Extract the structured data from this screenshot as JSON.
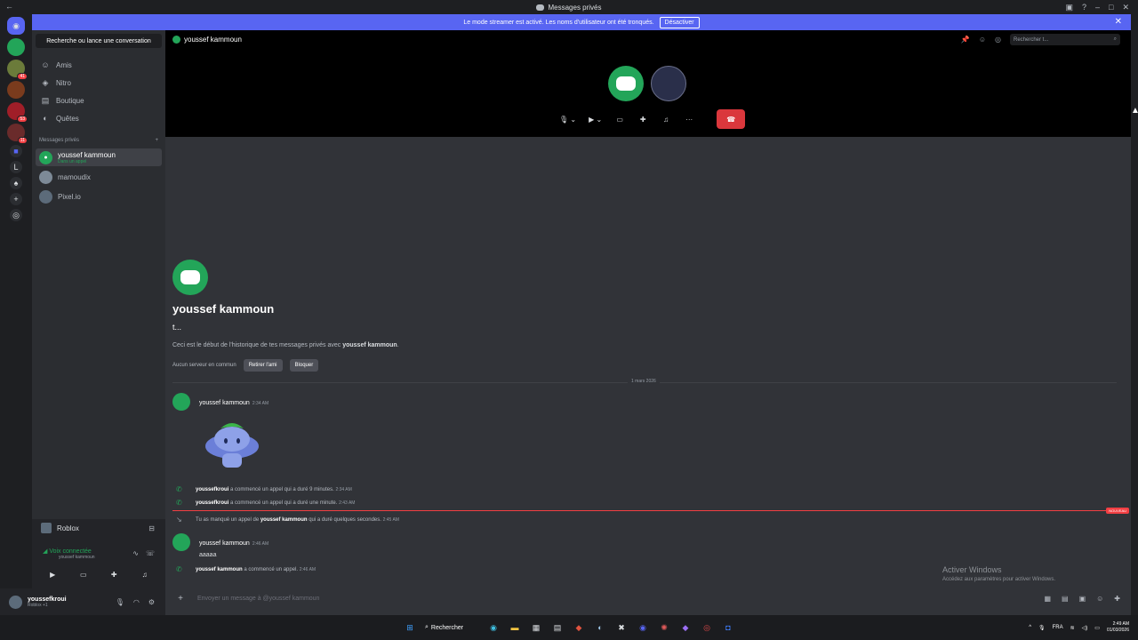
{
  "window": {
    "title": "Messages privés"
  },
  "banner": {
    "text": "Le mode streamer est activé. Les noms d'utilisateur ont été tronqués.",
    "button": "Désactiver"
  },
  "servers": [
    {
      "name": "home",
      "badge": ""
    },
    {
      "name": "server-1",
      "badge": ""
    },
    {
      "name": "server-2",
      "badge": "41"
    },
    {
      "name": "server-3",
      "badge": ""
    },
    {
      "name": "server-4",
      "badge": "53"
    },
    {
      "name": "server-5",
      "badge": "11"
    },
    {
      "name": "server-6",
      "badge": ""
    },
    {
      "name": "server-L",
      "label": "L",
      "badge": ""
    }
  ],
  "sidebar": {
    "search": "Recherche ou lance une conversation",
    "nav": [
      {
        "label": "Amis",
        "icon": "friends-icon"
      },
      {
        "label": "Nitro",
        "icon": "nitro-icon"
      },
      {
        "label": "Boutique",
        "icon": "shop-icon"
      },
      {
        "label": "Quêtes",
        "icon": "quests-icon"
      }
    ],
    "dm_header": "Messages privés",
    "dms": [
      {
        "name": "youssef kammoun",
        "status": "Dans un appel"
      },
      {
        "name": "mamoudix",
        "status": ""
      },
      {
        "name": "Pixel.io",
        "status": ""
      }
    ]
  },
  "rtc": {
    "game": "Roblox",
    "voice": "Voix connectée",
    "voice_channel": "youssef kammoun"
  },
  "user": {
    "name": "youssefkroui",
    "status": "Roblox +1"
  },
  "header": {
    "name": "youssef kammoun",
    "search_placeholder": "Rechercher t..."
  },
  "chat": {
    "name": "youssef kammoun",
    "tag": "t...",
    "desc_prefix": "Ceci est le début de l'historique de tes messages privés avec ",
    "desc_name": "youssef kammoun",
    "desc_suffix": ".",
    "no_common": "Aucun serveur en commun",
    "remove_friend": "Retirer l'ami",
    "block": "Bloquer",
    "date": "1 mars 2026",
    "messages": [
      {
        "author": "youssef kammoun",
        "time": "2:34 AM",
        "text": ""
      },
      {
        "author": "youssef kammoun",
        "time": "2:46 AM",
        "text": "aaaaa"
      }
    ],
    "system": [
      {
        "actor": "youssefkroui",
        "text": " a commencé un appel qui a duré 9 minutes.",
        "time": "2:34 AM"
      },
      {
        "actor": "youssefkroui",
        "text": " a commencé un appel qui a duré une minute.",
        "time": "2:43 AM"
      },
      {
        "prefix": "Tu as manqué un appel de ",
        "actor": "youssef kammoun",
        "text": " qui a duré quelques secondes.",
        "time": "2:45 AM"
      },
      {
        "actor": "youssef kammoun",
        "text": " a commencé un appel.",
        "time": "2:46 AM"
      }
    ],
    "new_label": "NOUVEAU",
    "composer_placeholder": "Envoyer un message à @youssef kammoun"
  },
  "activate": {
    "title": "Activer Windows",
    "sub": "Accédez aux paramètres pour activer Windows."
  },
  "taskbar": {
    "search": "Rechercher",
    "lang": "FRA",
    "time": "2:49 AM",
    "date": "01/03/2026"
  },
  "colors": {
    "blurple": "#5865f2",
    "green": "#23a559",
    "red": "#da373c"
  }
}
